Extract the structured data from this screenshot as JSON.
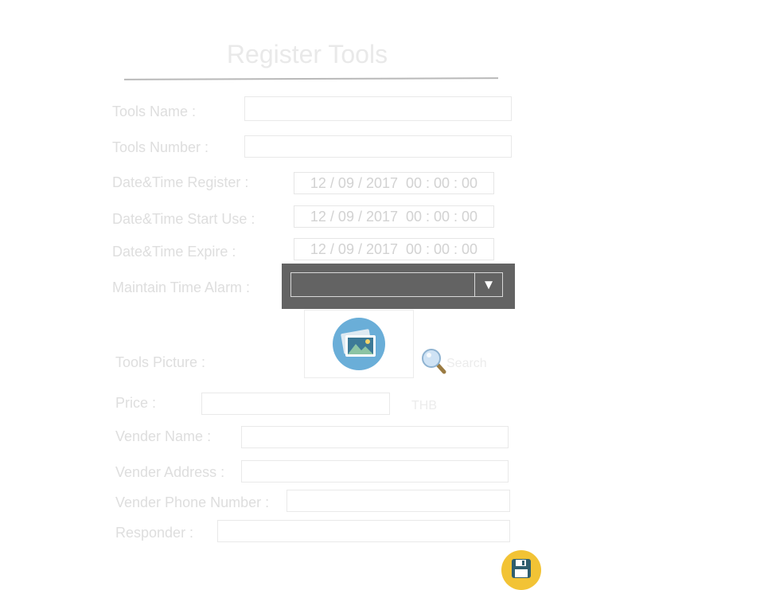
{
  "page": {
    "title": "Register Tools"
  },
  "form": {
    "tools_name_label": "Tools Name :",
    "tools_number_label": "Tools Number :",
    "register_label": "Date&Time Register  :",
    "register_value": "12 / 09 / 2017  00 : 00 : 00",
    "start_label": "Date&Time Start Use :",
    "start_value": "12 / 09 / 2017  00 : 00 : 00",
    "expire_label": "Date&Time Expire :",
    "expire_value": "12 / 09 / 2017  00 : 00 : 00",
    "alarm_label": "Maintain Time Alarm :",
    "alarm_value": "",
    "alarm_arrow": "▼",
    "picture_label": "Tools Picture :",
    "search_label": "Search",
    "price_label": "Price :",
    "currency": "THB",
    "vender_name_label": "Vender Name :",
    "vender_address_label": "Vender Address :",
    "vender_phone_label": "Vender Phone Number :",
    "responder_label": "Responder :"
  },
  "icons": {
    "picture": "image-icon",
    "search": "magnifier-icon",
    "save": "floppy-disk-icon"
  },
  "colors": {
    "picture_icon_bg": "#6aaed8",
    "save_button": "#f2c335",
    "alarm_panel": "#636363"
  }
}
